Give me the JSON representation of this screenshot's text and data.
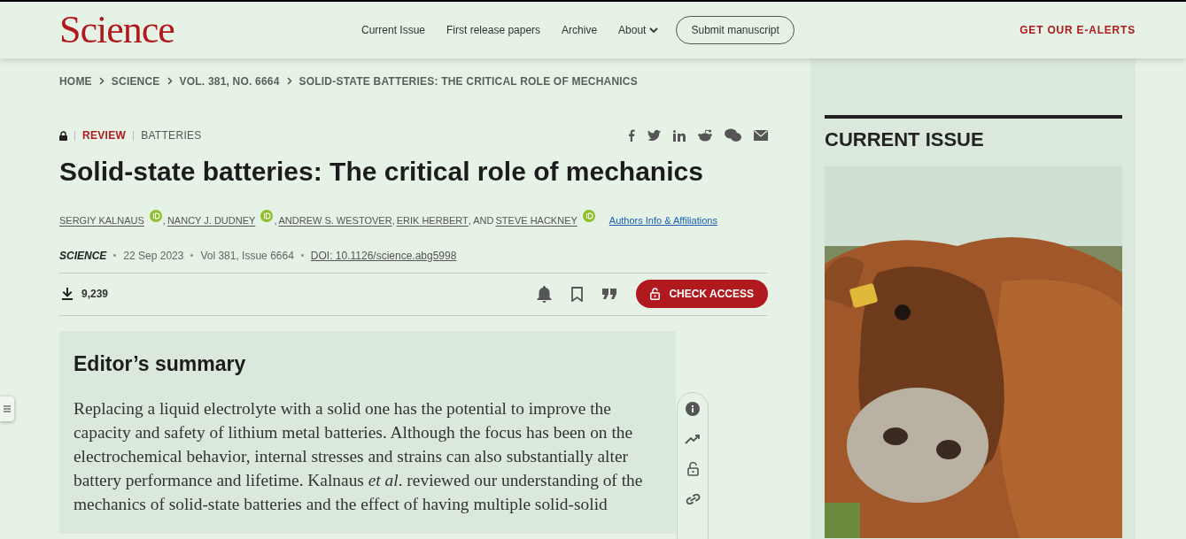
{
  "header": {
    "logo": "Science",
    "nav": [
      {
        "label": "Current Issue",
        "kind": "link"
      },
      {
        "label": "First release papers",
        "kind": "link"
      },
      {
        "label": "Archive",
        "kind": "link"
      },
      {
        "label": "About",
        "kind": "dropdown"
      },
      {
        "label": "Submit manuscript",
        "kind": "outlined"
      }
    ],
    "alerts": "GET OUR E-ALERTS"
  },
  "breadcrumb": [
    "HOME",
    "SCIENCE",
    "VOL. 381, NO. 6664",
    "SOLID-STATE BATTERIES: THE CRITICAL ROLE OF MECHANICS"
  ],
  "article": {
    "locked": true,
    "type": "REVIEW",
    "topic": "BATTERIES",
    "title": "Solid-state batteries: The critical role of mechanics",
    "authors": [
      {
        "name": "SERGIY KALNAUS",
        "orcid": true,
        "separator": " ,"
      },
      {
        "name": "NANCY J. DUDNEY",
        "orcid": true,
        "separator": " ,"
      },
      {
        "name": "ANDREW S. WESTOVER",
        "orcid": false,
        "separator": ","
      },
      {
        "name": "ERIK HERBERT",
        "orcid": false,
        "separator": ", AND"
      },
      {
        "name": "STEVE HACKNEY",
        "orcid": true
      }
    ],
    "affiliations_link": "Authors Info & Affiliations",
    "journal": "SCIENCE",
    "date": "22 Sep 2023",
    "volume": "Vol 381, Issue 6664",
    "doi": "DOI: 10.1126/science.abg5998",
    "downloads": "9,239",
    "check_access": "CHECK ACCESS"
  },
  "summary": {
    "heading": "Editor’s summary",
    "text": "Replacing a liquid electrolyte with a solid one has the potential to improve the capacity and safety of lithium metal batteries. Although the focus has been on the electrochemical behavior, internal stresses and strains can also substantially alter battery performance and lifetime. Kalnaus *et al*. reviewed our understanding of the mechanics of solid-state batteries and the effect of having multiple solid-solid"
  },
  "current_issue": {
    "heading": "CURRENT ISSUE"
  }
}
